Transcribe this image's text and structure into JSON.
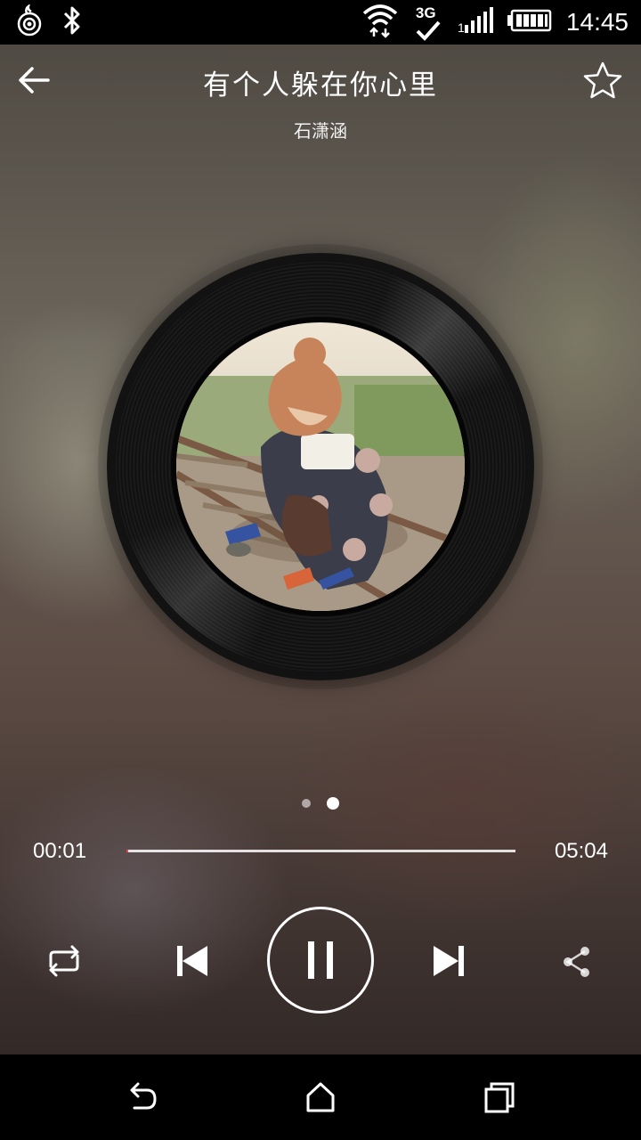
{
  "status_bar": {
    "time": "14:45",
    "network_label": "3G",
    "icons": [
      "app-notification-icon",
      "bluetooth-icon",
      "wifi-icon",
      "network-3g-icon",
      "signal-icon",
      "battery-icon"
    ]
  },
  "player": {
    "title": "有个人躲在你心里",
    "artist": "石潇涵",
    "favorited": false,
    "pages": {
      "count": 2,
      "current": 2
    },
    "progress": {
      "current_time": "00:01",
      "total_time": "05:04",
      "fraction": 0.003
    },
    "state": "playing",
    "controls": [
      "repeat-icon",
      "previous-icon",
      "pause-icon",
      "next-icon",
      "share-icon"
    ]
  },
  "nav_bar": {
    "icons": [
      "back-icon",
      "home-icon",
      "recents-icon"
    ]
  },
  "colors": {
    "accent": "#e84a4a",
    "text": "#ffffff",
    "bars": "#000000"
  }
}
